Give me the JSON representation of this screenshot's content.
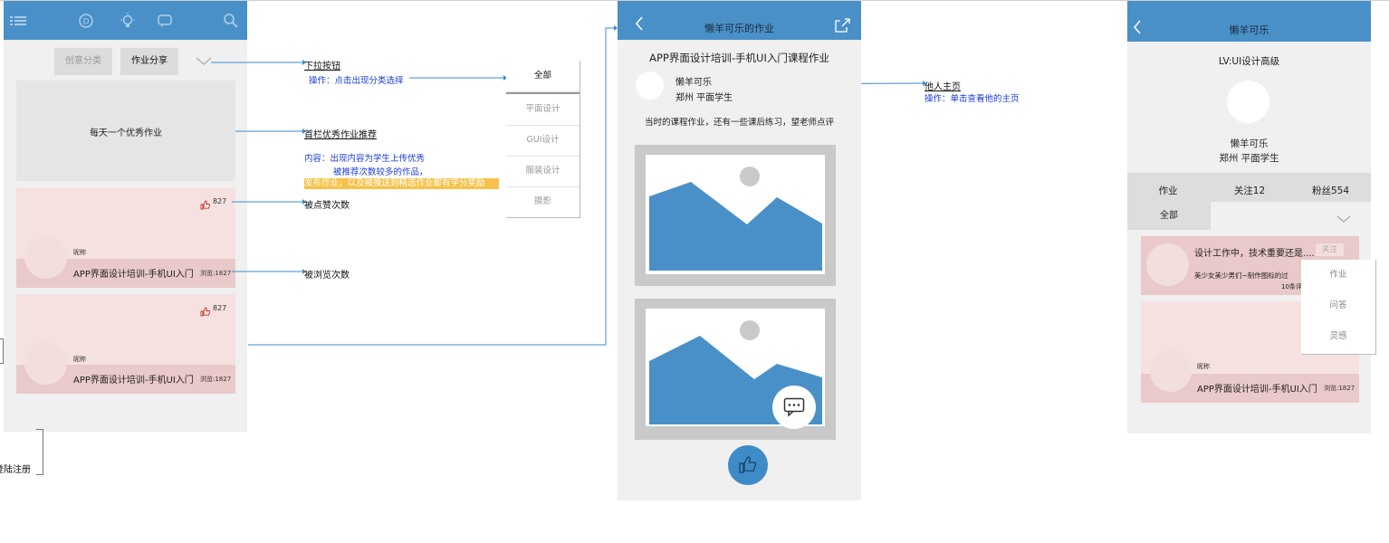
{
  "screen_feed": {
    "tabs": {
      "creative": "创意分类",
      "homework": "作业分享"
    },
    "banner_text": "每天一个优秀作业",
    "cards": [
      {
        "likes": "827",
        "nickname": "昵称",
        "title": "APP界面设计培训-手机UI入门",
        "views": "浏览:1827"
      },
      {
        "likes": "827",
        "nickname": "昵称",
        "title": "APP界面设计培训-手机UI入门",
        "views": "浏览:1827"
      }
    ],
    "header_icons": [
      "menu-icon",
      "d-circle-icon",
      "lightbulb-icon",
      "chat-icon",
      "search-icon"
    ]
  },
  "annotations": {
    "dropdown_title": "下拉按钮",
    "dropdown_op": "操作：点击出现分类选择",
    "featured_title": "首栏优秀作业推荐",
    "featured_line1": "内容：出现内容为学生上传优秀",
    "featured_line2": "被推荐次数较多的作品，",
    "featured_line3": "发布作业，以及被推送到精选作业都有学分奖励",
    "likes_note": "被点赞次数",
    "views_note": "被浏览次数",
    "profile_title": "他人主页",
    "profile_op": "操作：单击查看他的主页",
    "login_note": "登陆注册"
  },
  "category_dropdown": [
    "全部",
    "平面设计",
    "GUI设计",
    "服装设计",
    "摄影"
  ],
  "screen_detail": {
    "header_title": "懒羊可乐的作业",
    "course_title": "APP界面设计培训-手机UI入门课程作业",
    "author": "懒羊可乐",
    "location": "郑州  平面学生",
    "description": "当时的课程作业，还有一些课后练习，望老师点评"
  },
  "screen_profile": {
    "header_title": "懒羊可乐",
    "level": "LV:UI设计高级",
    "name": "懒羊可乐",
    "location": "郑州  平面学生",
    "stats": [
      "作业",
      "关注12",
      "粉丝554"
    ],
    "filter": "全部",
    "post1_title": "设计工作中，技术重要还是....",
    "post1_follow": "关注",
    "post1_sub": "美少女美少男们~制作图标的过",
    "post1_comments": "10条评",
    "post2_nickname": "昵称",
    "post2_title": "APP界面设计培训-手机UI入门",
    "post2_views": "浏览:1827",
    "menu": [
      "作业",
      "问答",
      "灵感"
    ]
  },
  "colors": {
    "header_blue": "#4a90c8",
    "annotation_blue": "#1a3bd6",
    "highlight": "#f7c24a",
    "connector": "#3b8bd0"
  }
}
